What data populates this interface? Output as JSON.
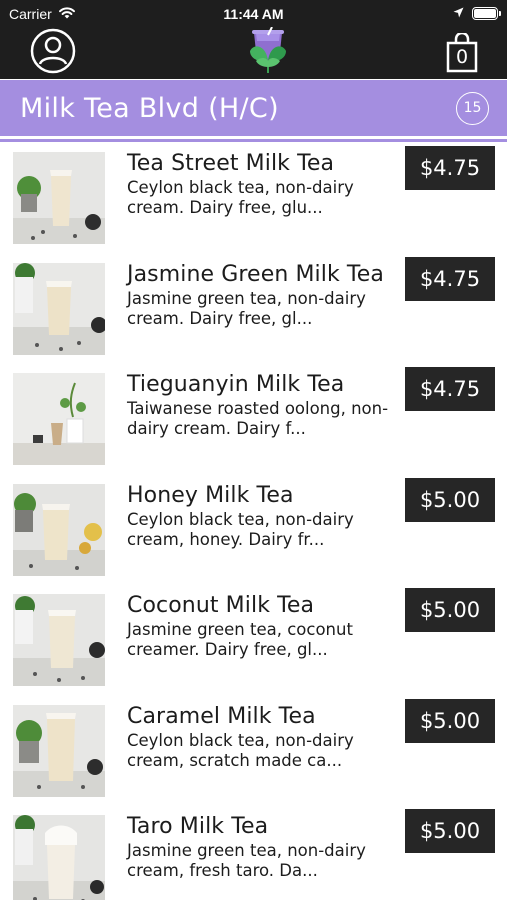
{
  "status_bar": {
    "carrier": "Carrier",
    "time": "11:44 AM"
  },
  "nav": {
    "profile_icon": "user-circle-icon",
    "logo_icon": "tea-cup-leaf-logo",
    "bag_icon": "shopping-bag-icon",
    "bag_count": "0"
  },
  "section": {
    "title": "Milk Tea Blvd (H/C)",
    "count": "15"
  },
  "colors": {
    "header_purple": "#a48ee0",
    "bar_dark": "#1e1e1e",
    "price_bg": "#262626"
  },
  "items": [
    {
      "name": "Tea Street Milk Tea",
      "description": "Ceylon black tea, non-dairy cream. Dairy free, glu...",
      "price": "$4.75"
    },
    {
      "name": "Jasmine Green Milk Tea",
      "description": "Jasmine green tea, non-dairy cream. Dairy free, gl...",
      "price": "$4.75"
    },
    {
      "name": "Tieguanyin Milk Tea",
      "description": "Taiwanese roasted oolong, non-dairy cream. Dairy f...",
      "price": "$4.75"
    },
    {
      "name": "Honey Milk Tea",
      "description": "Ceylon black tea, non-dairy cream, honey. Dairy fr...",
      "price": "$5.00"
    },
    {
      "name": "Coconut Milk Tea",
      "description": "Jasmine green tea, coconut creamer. Dairy free, gl...",
      "price": "$5.00"
    },
    {
      "name": "Caramel Milk Tea",
      "description": "Ceylon black tea, non-dairy cream, scratch made ca...",
      "price": "$5.00"
    },
    {
      "name": "Taro Milk Tea",
      "description": "Jasmine green tea, non-dairy cream, fresh taro. Da...",
      "price": "$5.00"
    }
  ]
}
